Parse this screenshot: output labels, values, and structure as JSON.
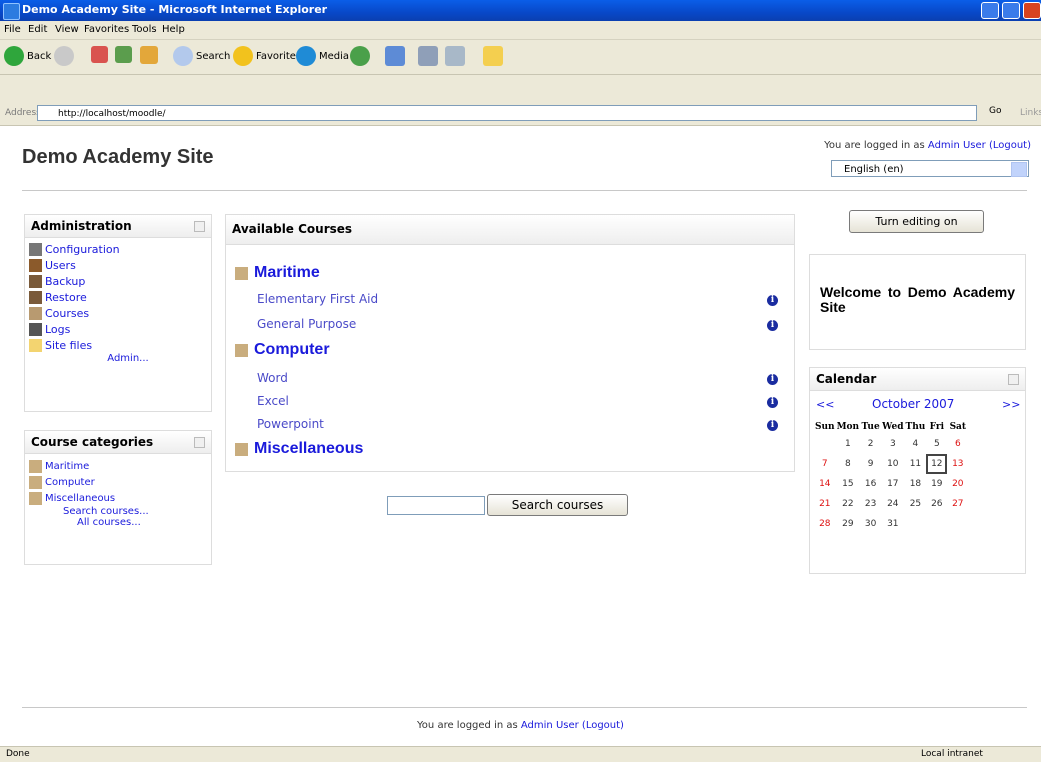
{
  "window": {
    "title": "Demo Academy Site - Microsoft Internet Explorer"
  },
  "menu": [
    "File",
    "Edit",
    "View",
    "Favorites",
    "Tools",
    "Help"
  ],
  "toolbar": {
    "back": "Back",
    "search": "Search",
    "favorites": "Favorites",
    "media": "Media"
  },
  "address": {
    "label": "Address",
    "url": "http://localhost/moodle/",
    "go": "Go",
    "links": "Links"
  },
  "header": {
    "site_title": "Demo Academy Site",
    "login_prefix": "You are logged in as ",
    "user": "Admin User",
    "logout": "(Logout)",
    "language": "English (en)"
  },
  "admin_block": {
    "title": "Administration",
    "items": [
      "Configuration",
      "Users",
      "Backup",
      "Restore",
      "Courses",
      "Logs",
      "Site files"
    ],
    "more": "Admin..."
  },
  "categories_block": {
    "title": "Course categories",
    "items": [
      "Maritime",
      "Computer",
      "Miscellaneous"
    ],
    "search": "Search courses...",
    "all": "All courses..."
  },
  "courses_block": {
    "title": "Available Courses",
    "categories": [
      {
        "name": "Maritime",
        "courses": [
          "Elementary First Aid",
          "General Purpose"
        ]
      },
      {
        "name": "Computer",
        "courses": [
          "Word",
          "Excel",
          "Powerpoint"
        ]
      },
      {
        "name": "Miscellaneous",
        "courses": []
      }
    ],
    "search_button": "Search courses"
  },
  "editing_button": "Turn editing on",
  "welcome": "Welcome to Demo Academy Site",
  "calendar": {
    "title": "Calendar",
    "prev": "<<",
    "month": "October 2007",
    "next": ">>",
    "days": [
      "Sun",
      "Mon",
      "Tue",
      "Wed",
      "Thu",
      "Fri",
      "Sat"
    ],
    "weeks": [
      [
        "",
        "1",
        "2",
        "3",
        "4",
        "5",
        "6"
      ],
      [
        "7",
        "8",
        "9",
        "10",
        "11",
        "12",
        "13"
      ],
      [
        "14",
        "15",
        "16",
        "17",
        "18",
        "19",
        "20"
      ],
      [
        "21",
        "22",
        "23",
        "24",
        "25",
        "26",
        "27"
      ],
      [
        "28",
        "29",
        "30",
        "31",
        "",
        "",
        ""
      ]
    ],
    "today": "12"
  },
  "footer": {
    "prefix": "You are logged in as ",
    "user": "Admin User",
    "logout": "(Logout)"
  },
  "status": {
    "left": "Done",
    "right": "Local intranet"
  }
}
